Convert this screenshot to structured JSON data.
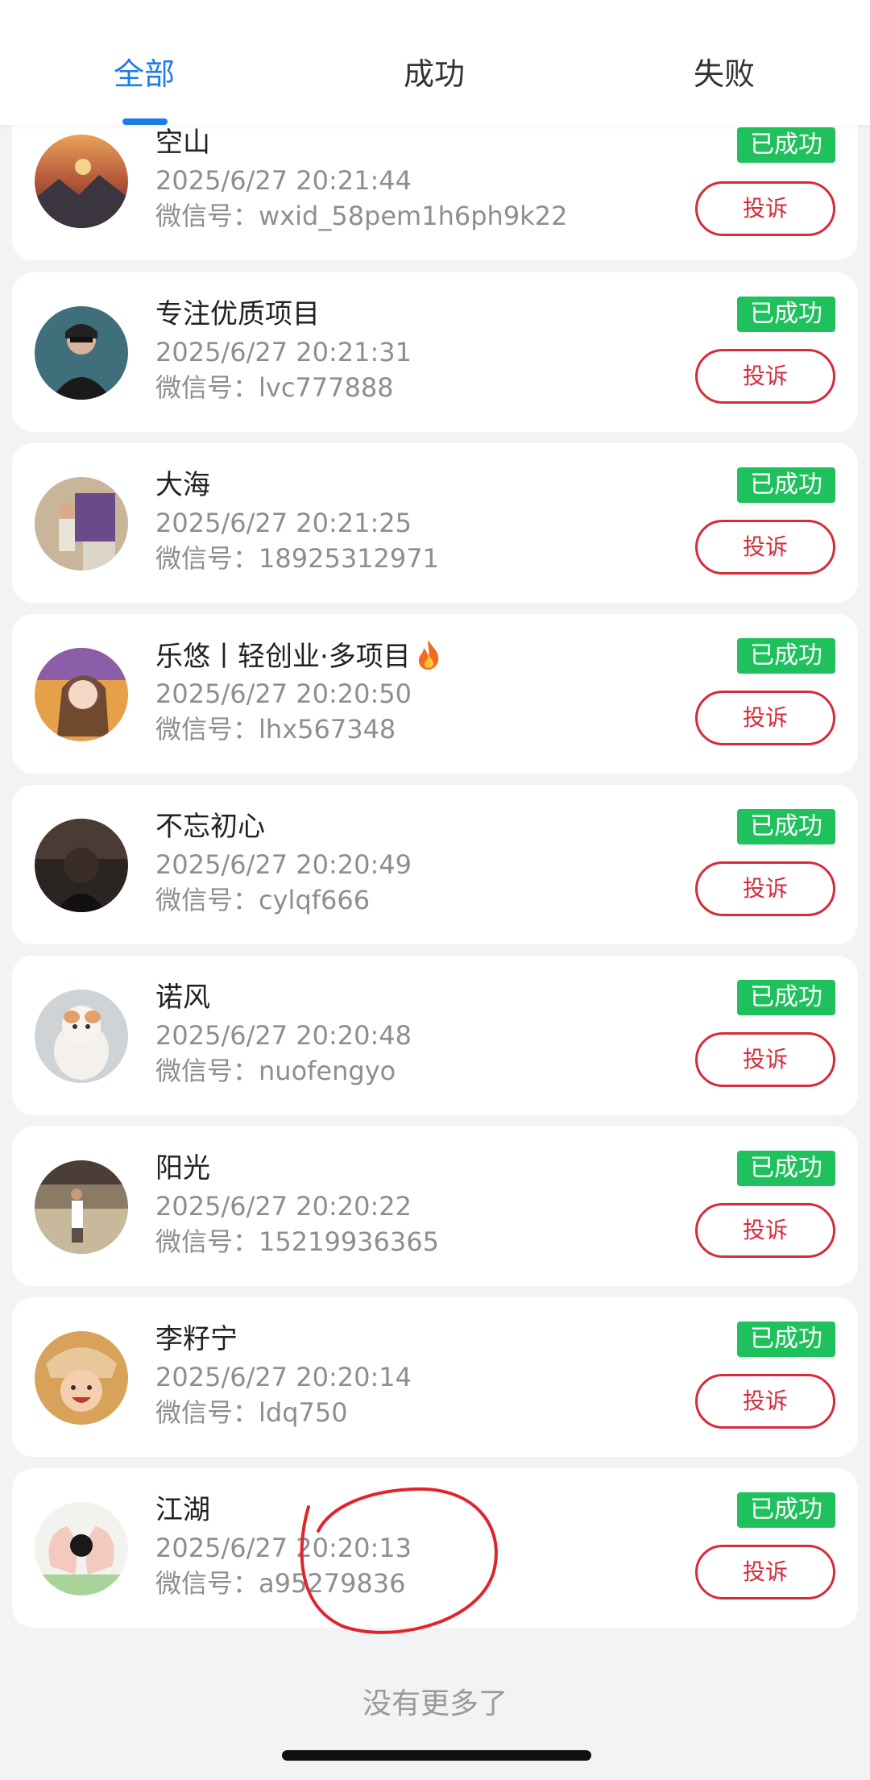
{
  "tabs": [
    {
      "label": "全部",
      "active": true
    },
    {
      "label": "成功",
      "active": false
    },
    {
      "label": "失败",
      "active": false
    }
  ],
  "colors": {
    "accent": "#1e7ce6",
    "success_badge": "#1fc15c",
    "complain": "#d62b3a",
    "annotation": "#e0242b"
  },
  "records": [
    {
      "name": "空山",
      "time": "2025/6/27 20:21:44",
      "wechat_label": "微信号：",
      "wechat_id": "wxid_58pem1h6ph9k22",
      "status": "已成功",
      "action": "投诉"
    },
    {
      "name": "专注优质项目",
      "time": "2025/6/27 20:21:31",
      "wechat_label": "微信号：",
      "wechat_id": "lvc777888",
      "status": "已成功",
      "action": "投诉"
    },
    {
      "name": "大海",
      "time": "2025/6/27 20:21:25",
      "wechat_label": "微信号：",
      "wechat_id": "18925312971",
      "status": "已成功",
      "action": "投诉"
    },
    {
      "name": "乐悠丨轻创业·多项目",
      "time": "2025/6/27 20:20:50",
      "wechat_label": "微信号：",
      "wechat_id": "lhx567348",
      "status": "已成功",
      "action": "投诉",
      "emoji": "fire-icon"
    },
    {
      "name": "不忘初心",
      "time": "2025/6/27 20:20:49",
      "wechat_label": "微信号：",
      "wechat_id": "cylqf666",
      "status": "已成功",
      "action": "投诉"
    },
    {
      "name": "诺风",
      "time": "2025/6/27 20:20:48",
      "wechat_label": "微信号：",
      "wechat_id": "nuofengyo",
      "status": "已成功",
      "action": "投诉"
    },
    {
      "name": "阳光",
      "time": "2025/6/27 20:20:22",
      "wechat_label": "微信号：",
      "wechat_id": "15219936365",
      "status": "已成功",
      "action": "投诉"
    },
    {
      "name": "李籽宁",
      "time": "2025/6/27 20:20:14",
      "wechat_label": "微信号：",
      "wechat_id": "ldq750",
      "status": "已成功",
      "action": "投诉"
    },
    {
      "name": "江湖",
      "time": "2025/6/27 20:20:13",
      "wechat_label": "微信号：",
      "wechat_id": "a95279836",
      "status": "已成功",
      "action": "投诉"
    }
  ],
  "footer": {
    "no_more": "没有更多了"
  }
}
